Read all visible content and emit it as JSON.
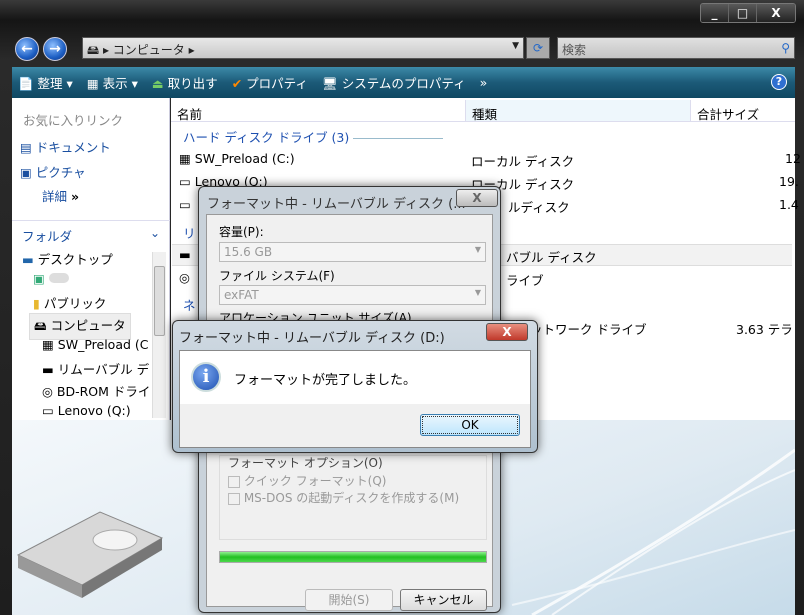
{
  "window": {
    "controls": [
      "_",
      "□",
      "X"
    ]
  },
  "address": {
    "path": "コンピュータ",
    "search_placeholder": "検索"
  },
  "toolbar": {
    "organize": "整理",
    "view": "表示",
    "eject": "取り出す",
    "properties": "プロパティ",
    "system_properties": "システムのプロパティ",
    "more": "»"
  },
  "favorites": {
    "title": "お気に入りリンク",
    "items": [
      "ドキュメント",
      "ピクチャ"
    ],
    "more": "詳細"
  },
  "folders": {
    "title": "フォルダ",
    "items": [
      "デスクトップ",
      "",
      "パブリック",
      "コンピュータ",
      "SW_Preload (C",
      "リムーバブル デ",
      "BD-ROM ドライ",
      "Lenovo (Q:)"
    ]
  },
  "columns": {
    "name": "名前",
    "type": "種類",
    "size": "合計サイズ"
  },
  "groups": {
    "hdd": "ハード ディスク ドライブ (3)",
    "removable": "リ",
    "network": "ネ"
  },
  "rows": [
    {
      "name": "SW_Preload (C:)",
      "type": "ローカル ディスク",
      "size": "12"
    },
    {
      "name": "Lenovo (Q:)",
      "type": "ローカル ディスク",
      "size": "19."
    },
    {
      "name": "",
      "type": "ルディスク",
      "size": "1.4"
    },
    {
      "name": "",
      "type": "バブル ディスク",
      "size": ""
    },
    {
      "name": "",
      "type": "ライブ",
      "size": ""
    },
    {
      "name": "",
      "type": "ットワーク ドライブ",
      "size": "3.63 テラ"
    }
  ],
  "format_dialog": {
    "title": "フォーマット中 - リムーバブル ディスク (...",
    "capacity_label": "容量(P):",
    "capacity": "15.6 GB",
    "fs_label": "ファイル システム(F)",
    "fs": "exFAT",
    "alloc_label": "アロケーション ユニット サイズ(A)",
    "options_label": "フォーマット オプション(O)",
    "quick": "クイック フォーマット(Q)",
    "msdos": "MS-DOS の起動ディスクを作成する(M)",
    "progress": 100,
    "start": "開始(S)",
    "cancel": "キャンセル",
    "close": "X"
  },
  "message_box": {
    "title": "フォーマット中 - リムーバブル ディスク (D:)",
    "message": "フォーマットが完了しました。",
    "ok": "OK",
    "close": "X"
  }
}
